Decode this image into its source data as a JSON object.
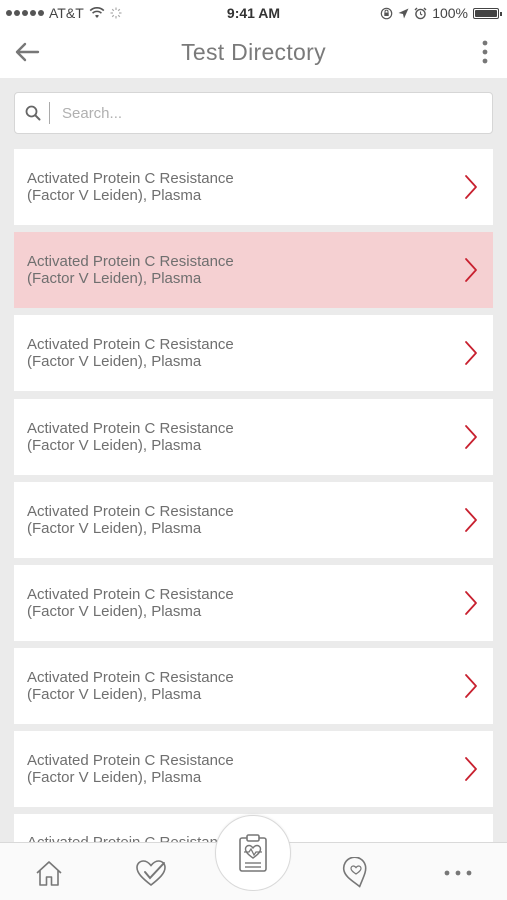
{
  "status_bar": {
    "carrier": "AT&T",
    "time": "9:41 AM",
    "battery_percent": "100%",
    "battery_level": 1.0
  },
  "nav": {
    "title": "Test Directory",
    "back_icon": "arrow-left-icon",
    "more_icon": "vertical-dots-icon"
  },
  "search": {
    "placeholder": "Search..."
  },
  "list": {
    "items": [
      {
        "line1": "Activated Protein C Resistance",
        "line2": "(Factor V Leiden), Plasma",
        "selected": false
      },
      {
        "line1": "Activated Protein C Resistance",
        "line2": "(Factor V Leiden), Plasma",
        "selected": true
      },
      {
        "line1": "Activated Protein C Resistance",
        "line2": "(Factor V Leiden), Plasma",
        "selected": false
      },
      {
        "line1": "Activated Protein C Resistance",
        "line2": "(Factor V Leiden), Plasma",
        "selected": false
      },
      {
        "line1": "Activated Protein C Resistance",
        "line2": "(Factor V Leiden), Plasma",
        "selected": false
      },
      {
        "line1": "Activated Protein C Resistance",
        "line2": "(Factor V Leiden), Plasma",
        "selected": false
      },
      {
        "line1": "Activated Protein C Resistance",
        "line2": "(Factor V Leiden), Plasma",
        "selected": false
      },
      {
        "line1": "Activated Protein C Resistance",
        "line2": "(Factor V Leiden), Plasma",
        "selected": false
      }
    ],
    "partial_item_text": "Activated Protein C Resistance"
  },
  "tab_bar": {
    "tabs": [
      "home-icon",
      "heart-check-icon",
      "clipboard-heart-icon",
      "location-heart-icon",
      "more-horizontal-icon"
    ]
  },
  "colors": {
    "accent": "#c8202f",
    "selected_row": "#f5d0d2",
    "background": "#ebebeb"
  }
}
